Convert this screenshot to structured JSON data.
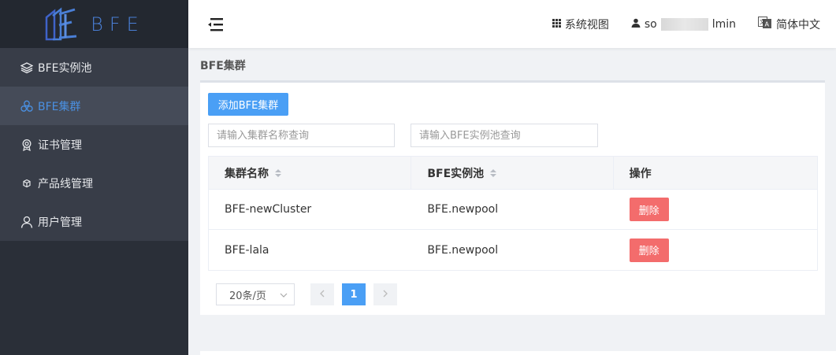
{
  "app": {
    "logo_text": "BFE"
  },
  "sidebar": {
    "items": [
      {
        "label": "BFE实例池",
        "icon": "layers-icon",
        "active": false
      },
      {
        "label": "BFE集群",
        "icon": "cluster-icon",
        "active": true
      },
      {
        "label": "证书管理",
        "icon": "certificate-icon",
        "active": false
      },
      {
        "label": "产品线管理",
        "icon": "cube-icon",
        "active": false
      },
      {
        "label": "用户管理",
        "icon": "user-icon",
        "active": false
      }
    ]
  },
  "header": {
    "system_view": "系统视图",
    "user_prefix": "so",
    "user_suffix": "lmin",
    "language": "简体中文"
  },
  "page": {
    "title": "BFE集群",
    "add_button": "添加BFE集群",
    "search_cluster_placeholder": "请输入集群名称查询",
    "search_pool_placeholder": "请输入BFE实例池查询"
  },
  "table": {
    "columns": [
      "集群名称",
      "BFE实例池",
      "操作"
    ],
    "rows": [
      {
        "name": "BFE-newCluster",
        "pool": "BFE.newpool",
        "action": "删除"
      },
      {
        "name": "BFE-lala",
        "pool": "BFE.newpool",
        "action": "删除"
      }
    ]
  },
  "pagination": {
    "page_size": "20条/页",
    "current_page": "1"
  },
  "colors": {
    "primary": "#4a9ff5",
    "danger": "#f36c6c",
    "sidebar_bg": "#2a2f38",
    "active_text": "#4a90e2"
  }
}
